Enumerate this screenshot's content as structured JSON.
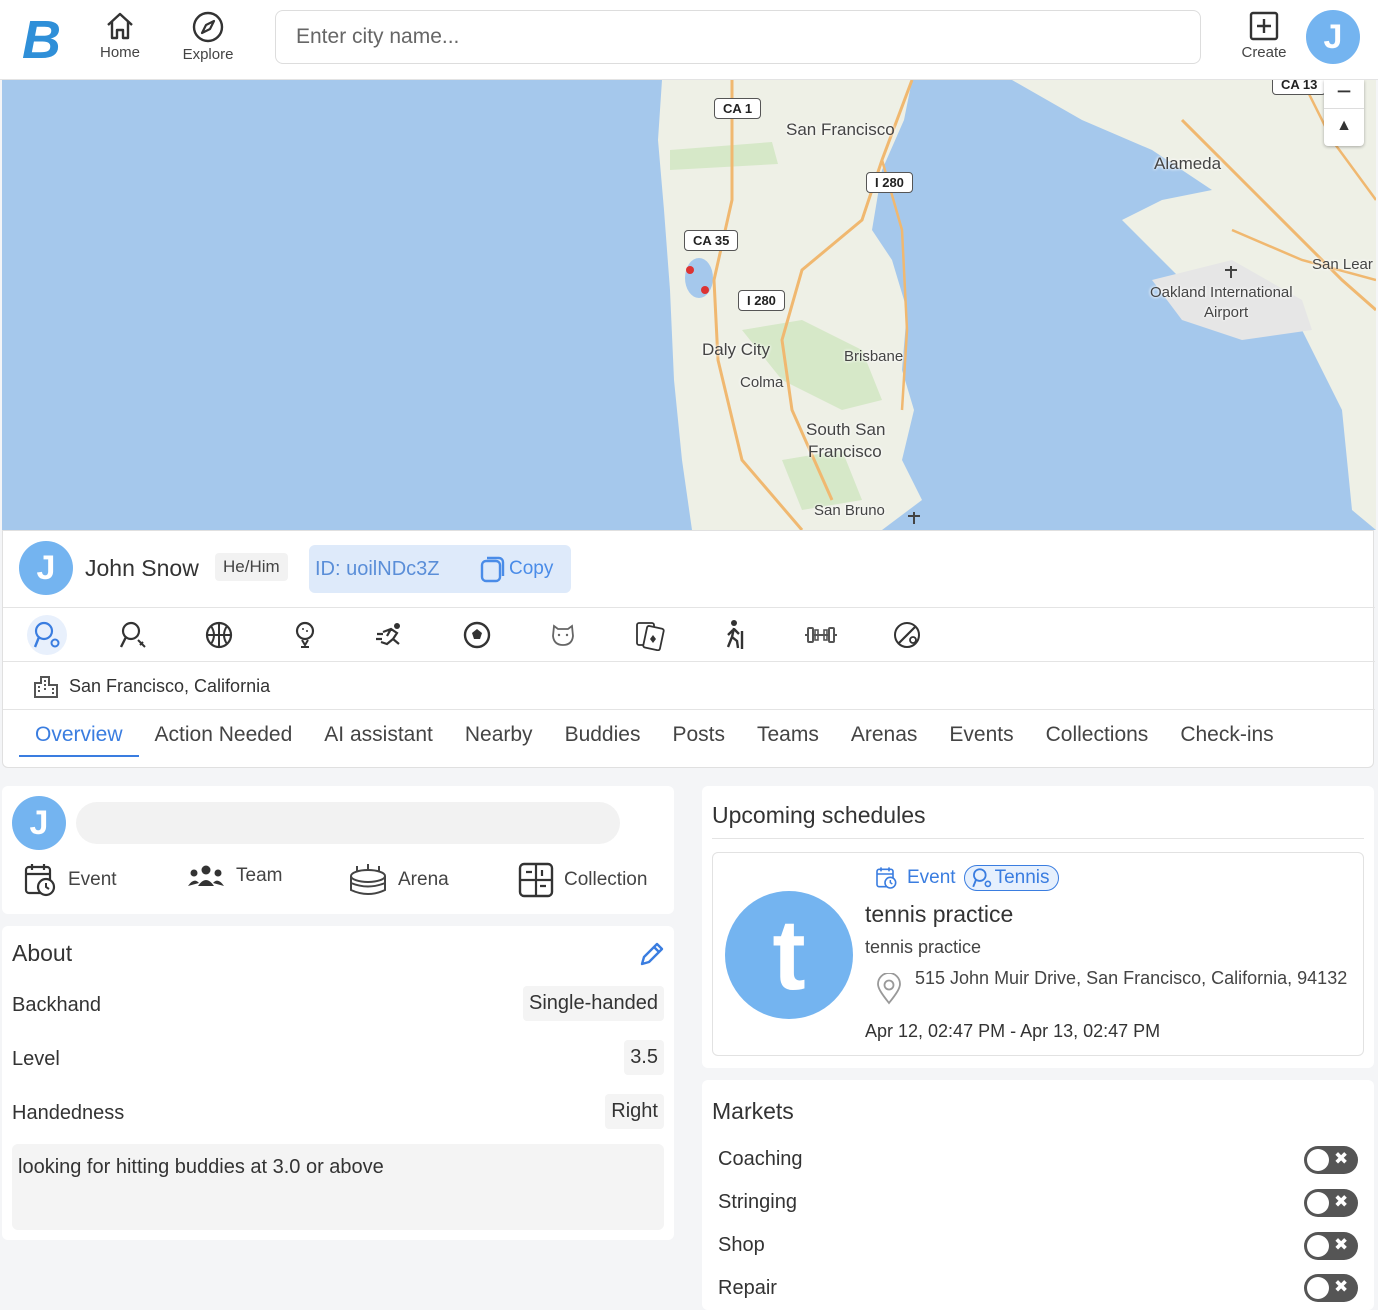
{
  "topbar": {
    "logo_letter": "B",
    "home_label": "Home",
    "explore_label": "Explore",
    "search_placeholder": "Enter city name...",
    "create_label": "Create",
    "user_initial": "J"
  },
  "map": {
    "labels": {
      "san_francisco": "San Francisco",
      "alameda": "Alameda",
      "daly_city": "Daly City",
      "brisbane": "Brisbane",
      "colma": "Colma",
      "south_sf": "South San",
      "south_sf2": "Francisco",
      "san_bruno": "San Bruno",
      "oakland_airport": "Oakland International",
      "oakland_airport2": "Airport",
      "san_leandro": "San Lear"
    },
    "shields": {
      "ca1": "CA 1",
      "i280a": "I 280",
      "ca35": "CA 35",
      "i280b": "I 280",
      "ca13": "CA 13"
    },
    "zoom_out": "−",
    "compass": "▲"
  },
  "profile": {
    "initial": "J",
    "name": "John Snow",
    "pronouns": "He/Him",
    "id_label": "ID:  uoilNDc3Z",
    "copy_label": "Copy",
    "location": "San Francisco, California"
  },
  "sports": [
    "tennis-icon",
    "badminton-icon",
    "basketball-icon",
    "golf-icon",
    "running-icon",
    "soccer-icon",
    "dog-icon",
    "cards-icon",
    "hiking-icon",
    "gym-icon",
    "baseball-icon"
  ],
  "tabs": [
    "Overview",
    "Action Needed",
    "AI assistant",
    "Nearby",
    "Buddies",
    "Posts",
    "Teams",
    "Arenas",
    "Events",
    "Collections",
    "Check-ins"
  ],
  "create": {
    "initial": "J",
    "event": "Event",
    "team": "Team",
    "arena": "Arena",
    "collection": "Collection"
  },
  "about": {
    "title": "About",
    "rows": [
      {
        "label": "Backhand",
        "value": "Single-handed"
      },
      {
        "label": "Level",
        "value": "3.5"
      },
      {
        "label": "Handedness",
        "value": "Right"
      }
    ],
    "bio": "looking for hitting buddies at 3.0 or above"
  },
  "schedules": {
    "title": "Upcoming schedules",
    "event": {
      "avatar": "t",
      "type": "Event",
      "sport": "Tennis",
      "title": "tennis practice",
      "subtitle": "tennis practice",
      "address": "515 John Muir Drive, San Francisco, California, 94132",
      "time": "Apr 12, 02:47 PM - Apr 13, 02:47 PM"
    }
  },
  "markets": {
    "title": "Markets",
    "items": [
      "Coaching",
      "Stringing",
      "Shop",
      "Repair"
    ],
    "toggle_off_symbol": "✖"
  },
  "colors": {
    "accent": "#3a7de0",
    "avatar": "#74b4f0",
    "water": "#a5c8ec",
    "land": "#eef0e6"
  }
}
